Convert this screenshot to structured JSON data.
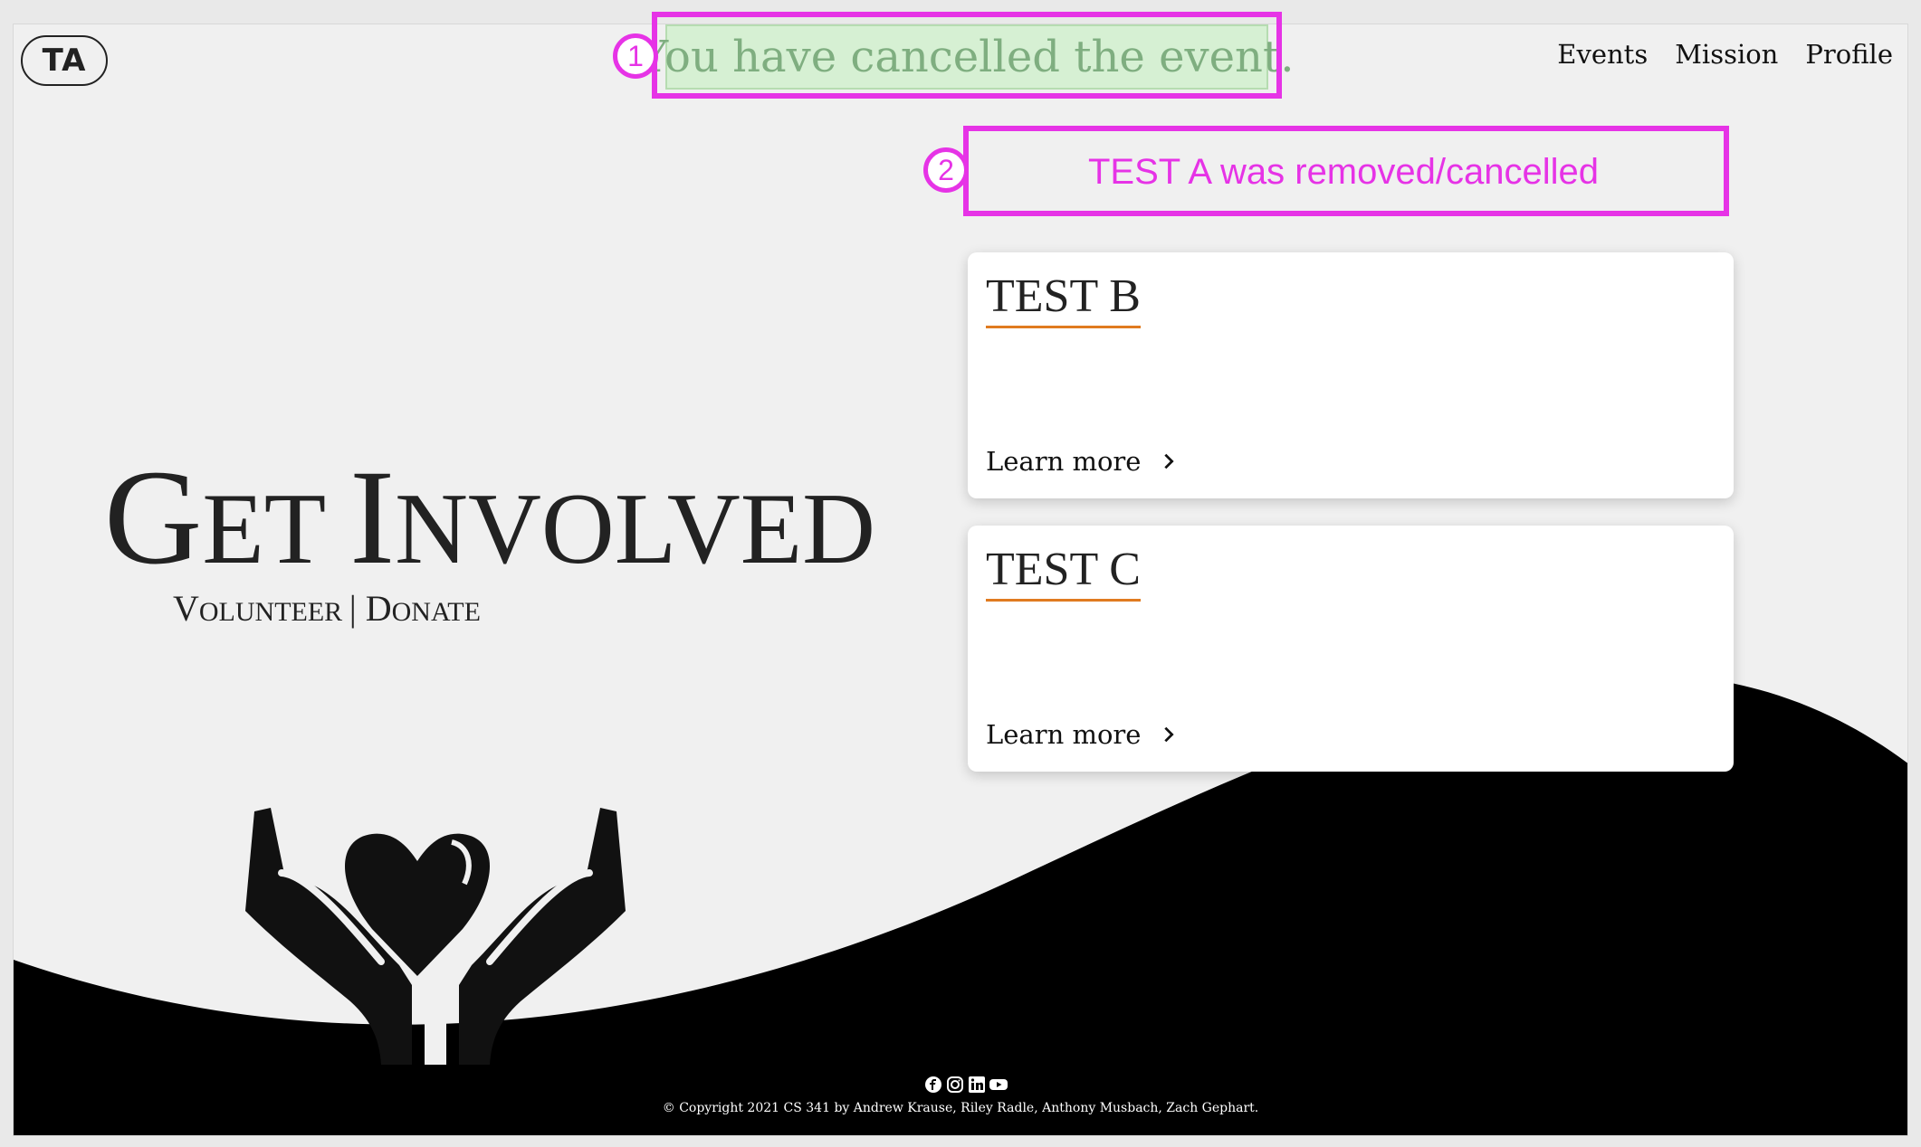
{
  "header": {
    "logo": "TA",
    "nav": [
      "Events",
      "Mission",
      "Profile"
    ]
  },
  "alert": {
    "text": "You have cancelled the event."
  },
  "notice": {
    "text": "TEST A was removed/cancelled"
  },
  "hero": {
    "title_parts": [
      {
        "text": "G",
        "size": "big"
      },
      {
        "text": "ET ",
        "size": "small"
      },
      {
        "text": "I",
        "size": "big"
      },
      {
        "text": "NVOLVED",
        "size": "small"
      }
    ],
    "subtitle_parts": [
      {
        "text": "V",
        "size": "big"
      },
      {
        "text": "OLUNTEER ",
        "size": "small"
      },
      {
        "text": "| ",
        "size": "big"
      },
      {
        "text": "D",
        "size": "big"
      },
      {
        "text": "ONATE",
        "size": "small"
      }
    ]
  },
  "events": [
    {
      "title": "TEST B",
      "link": "Learn more"
    },
    {
      "title": "TEST C",
      "link": "Learn more"
    }
  ],
  "footer": {
    "icons": [
      "facebook-icon",
      "instagram-icon",
      "linkedin-icon",
      "youtube-icon"
    ],
    "copyright": "© Copyright 2021 CS 341 by Andrew Krause, Riley Radle, Anthony Musbach, Zach Gephart."
  },
  "annotations": [
    "1",
    "2"
  ],
  "colors": {
    "annotation": "#e633e6",
    "alert_bg": "#d6f0d3",
    "alert_text": "#7fae80",
    "accent_underline": "#e07b20",
    "footer_bg": "#000000"
  }
}
